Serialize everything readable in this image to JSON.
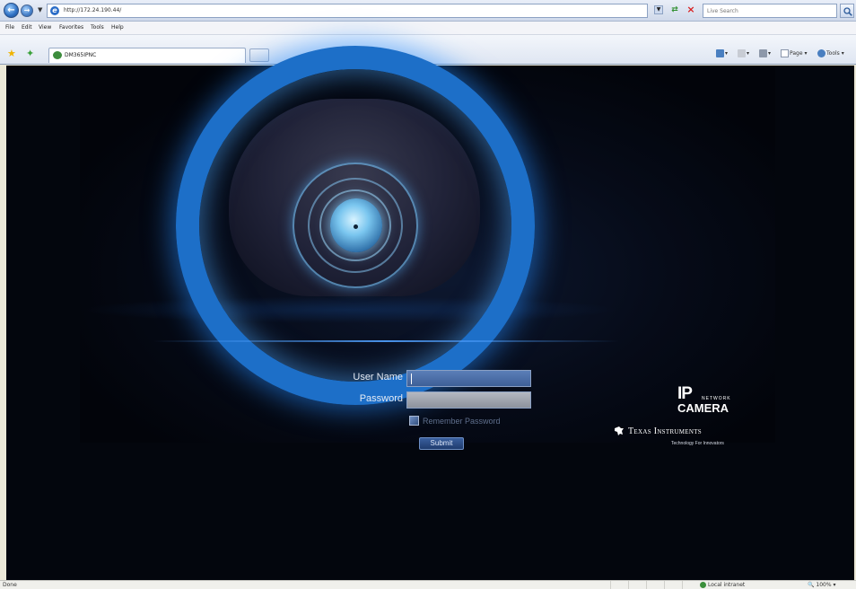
{
  "browser": {
    "url": "http://172.24.190.44/",
    "search_placeholder": "Live Search",
    "menu": [
      "File",
      "Edit",
      "View",
      "Favorites",
      "Tools",
      "Help"
    ],
    "tab_title": "DM365IPNC",
    "commands": {
      "page": "Page",
      "tools": "Tools"
    },
    "status": "Done",
    "zone": "Local intranet",
    "zoom": "100%"
  },
  "login": {
    "username_label": "User Name",
    "password_label": "Password",
    "username_value": "",
    "password_value": "",
    "remember_label": "Remember Password",
    "remember_checked": true,
    "submit_label": "Submit"
  },
  "branding": {
    "ip_big": "IP",
    "ip_network": "NETWORK",
    "ip_camera": "CAMERA",
    "company": "Texas Instruments",
    "tagline": "Technology For Innovators"
  },
  "icons": [
    "back-icon",
    "forward-icon",
    "page-icon",
    "refresh-icon",
    "stop-icon",
    "search-icon",
    "favorites-star-icon",
    "add-favorites-icon",
    "home-icon",
    "feeds-icon",
    "print-icon",
    "page-menu-icon",
    "tools-menu-icon",
    "ti-logo-icon",
    "globe-icon"
  ],
  "colors": {
    "accent_ring": "#1d6fc8",
    "background": "#03060d",
    "user_field": "#4a6ea8",
    "password_field": "#a2a6af"
  }
}
